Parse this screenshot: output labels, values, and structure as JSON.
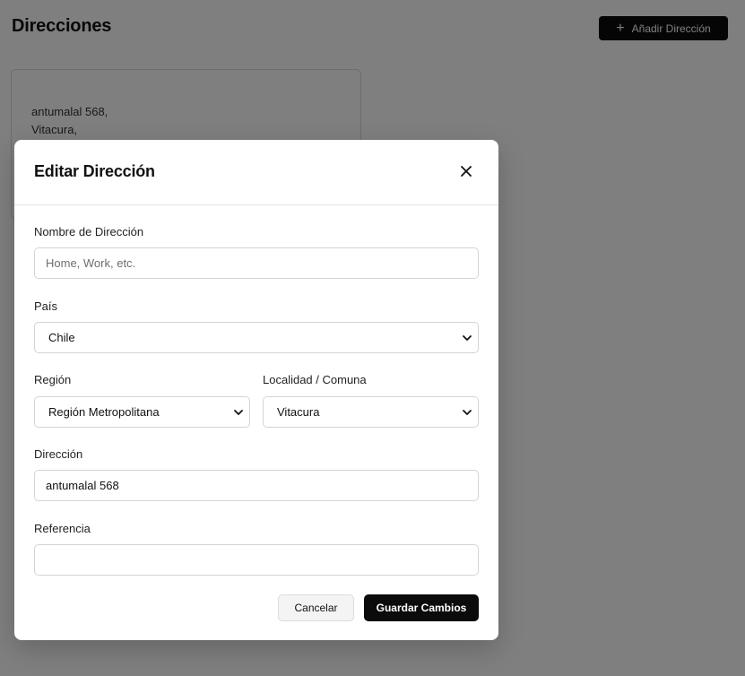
{
  "page": {
    "title": "Direcciones",
    "add_button_label": "Añadir Dirección",
    "add_button_icon": "plus-icon"
  },
  "address_card": {
    "line1": "antumalal 568,",
    "line2": "Vitacura,"
  },
  "modal": {
    "title": "Editar Dirección",
    "close_icon": "close-icon",
    "fields": {
      "name": {
        "label": "Nombre de Dirección",
        "value": "",
        "placeholder": "Home, Work, etc."
      },
      "country": {
        "label": "País",
        "value": "Chile"
      },
      "region": {
        "label": "Región",
        "value": "Región Metropolitana"
      },
      "commune": {
        "label": "Localidad / Comuna",
        "value": "Vitacura"
      },
      "address": {
        "label": "Dirección",
        "value": "antumalal 568"
      },
      "reference": {
        "label": "Referencia",
        "value": ""
      }
    },
    "cancel_label": "Cancelar",
    "save_label": "Guardar Cambios"
  },
  "colors": {
    "primary": "#0b0b0b",
    "overlay": "rgba(0,0,0,0.5)",
    "border": "#d4d4d4"
  }
}
